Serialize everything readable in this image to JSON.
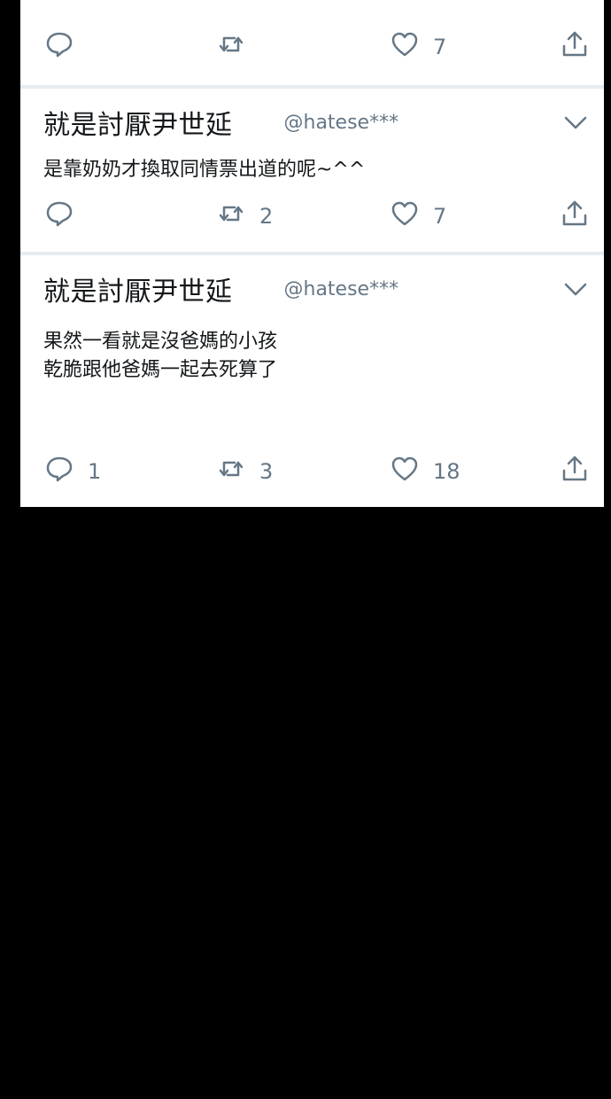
{
  "tweets": [
    {
      "display_name": "",
      "handle": "",
      "body": "",
      "reply_count": "",
      "retweet_count": "",
      "like_count": "7",
      "icons": [
        "reply-icon",
        "retweet-icon",
        "like-icon",
        "share-icon"
      ]
    },
    {
      "display_name": "就是討厭尹世延",
      "handle": "@hatese***",
      "body": "是靠奶奶才換取同情票出道的呢~^^",
      "reply_count": "",
      "retweet_count": "2",
      "like_count": "7",
      "icons": [
        "chevron-down-icon",
        "reply-icon",
        "retweet-icon",
        "like-icon",
        "share-icon"
      ]
    },
    {
      "display_name": "就是討厭尹世延",
      "handle": "@hatese***",
      "body_line1": "果然一看就是沒爸媽的小孩",
      "body_line2": "乾脆跟他爸媽一起去死算了",
      "reply_count": "1",
      "retweet_count": "3",
      "like_count": "18",
      "icons": [
        "chevron-down-icon",
        "reply-icon",
        "retweet-icon",
        "like-icon",
        "share-icon"
      ]
    }
  ],
  "colors": {
    "background": "#000000",
    "card": "#ffffff",
    "text": "#14171a",
    "muted": "#657786",
    "divider": "#e6ecf0"
  }
}
